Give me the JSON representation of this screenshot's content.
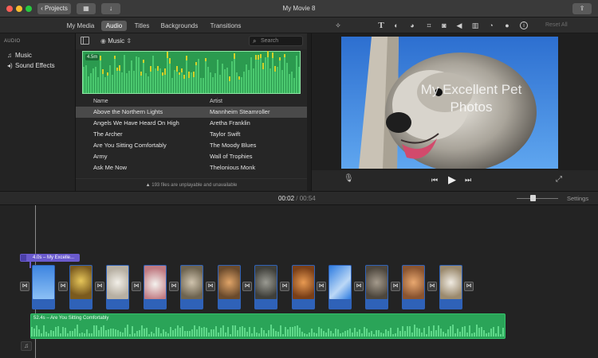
{
  "window": {
    "title": "My Movie 8",
    "projects_label": "Projects"
  },
  "tabs": [
    {
      "label": "My Media",
      "active": false
    },
    {
      "label": "Audio",
      "active": true
    },
    {
      "label": "Titles",
      "active": false
    },
    {
      "label": "Backgrounds",
      "active": false
    },
    {
      "label": "Transitions",
      "active": false
    }
  ],
  "tools": {
    "reset_all": "Reset All"
  },
  "sidebar": {
    "header": "AUDIO",
    "items": [
      {
        "label": "Music",
        "icon": "music-note-icon"
      },
      {
        "label": "Sound Effects",
        "icon": "speaker-icon"
      }
    ]
  },
  "browser": {
    "source_label": "Music",
    "search_placeholder": "Search",
    "preview_duration": "4.5m",
    "columns": {
      "name": "Name",
      "artist": "Artist"
    },
    "rows": [
      {
        "name": "Above the Northern Lights",
        "artist": "Mannheim Steamroller",
        "selected": true
      },
      {
        "name": "Angels We Have Heard On High",
        "artist": "Aretha Franklin",
        "selected": false
      },
      {
        "name": "The Archer",
        "artist": "Taylor Swift",
        "selected": false
      },
      {
        "name": "Are You Sitting Comfortably",
        "artist": "The Moody Blues",
        "selected": false
      },
      {
        "name": "Army",
        "artist": "Wall of Trophies",
        "selected": false
      },
      {
        "name": "Ask Me Now",
        "artist": "Thelonious Monk",
        "selected": false
      }
    ],
    "footer": "193 files are unplayable and unavailable"
  },
  "viewer": {
    "title_overlay": "My Excellent Pet Photos"
  },
  "timeline": {
    "current_time": "00:02",
    "separator": "/",
    "total_time": "00:54",
    "settings_label": "Settings",
    "title_clip_label": "4.0s – My Excelle...",
    "audio_clip_label": "52.4s – Are You Sitting Comfortably",
    "transition_glyph": "⋈"
  },
  "colors": {
    "accent_green": "#2aa458",
    "clip_blue": "#2f62b8",
    "title_clip_purple": "#6a5acd"
  }
}
